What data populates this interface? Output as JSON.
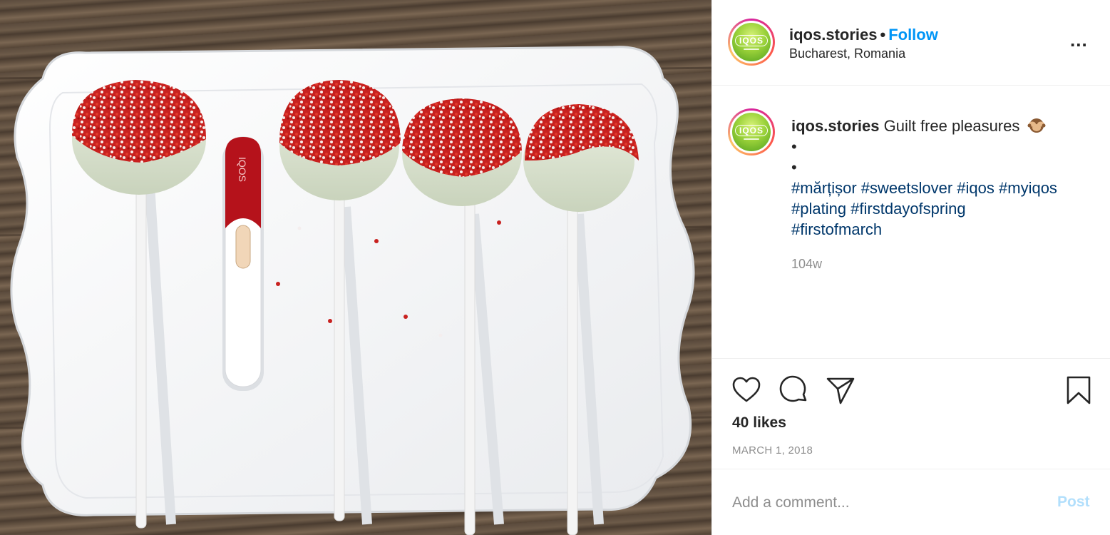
{
  "post": {
    "username": "iqos.stories",
    "separator": "•",
    "follow_label": "Follow",
    "location": "Bucharest, Romania",
    "more_label": "...",
    "avatar_text": "IQOS"
  },
  "photo": {
    "device_text": "IQOS"
  },
  "caption": {
    "username": "iqos.stories",
    "text": "Guilt free pleasures",
    "emoji": "see-no-evil-monkey-icon",
    "bullet1": "•",
    "bullet2": "•",
    "hashtags_line1": "#mărțișor #sweetslover #iqos #myiqos",
    "hashtags_line2": "#plating #firstdayofspring",
    "hashtags_line3": "#firstofmarch",
    "time_ago": "104w"
  },
  "actions": {
    "icons": [
      "heart-icon",
      "comment-icon",
      "share-icon",
      "bookmark-icon"
    ],
    "likes": "40 likes",
    "date": "MARCH 1, 2018"
  },
  "comment": {
    "placeholder": "Add a comment...",
    "post_label": "Post"
  },
  "colors": {
    "link_blue": "#0095f6",
    "hashtag_blue": "#00376b",
    "post_disabled": "#b2dffc",
    "secondary_text": "#8e8e8e"
  }
}
